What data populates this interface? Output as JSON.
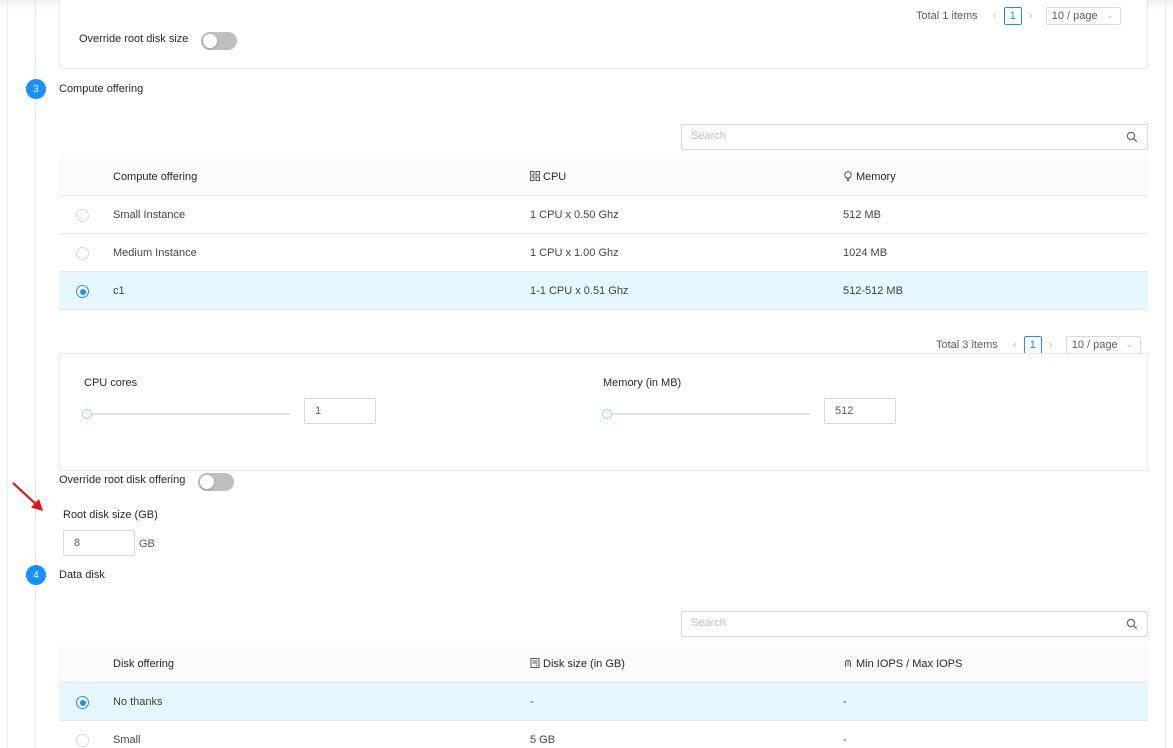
{
  "top_section": {
    "override_root_disk_size_label": "Override root disk size",
    "pagination": {
      "total": "Total 1 items",
      "current_page": "1",
      "page_size": "10 / page"
    }
  },
  "compute_step": {
    "number": "3",
    "title": "Compute offering",
    "search_placeholder": "Search",
    "columns": {
      "name": "Compute offering",
      "cpu": "CPU",
      "memory": "Memory"
    },
    "rows": [
      {
        "name": "Small Instance",
        "cpu": "1 CPU x 0.50 Ghz",
        "memory": "512 MB",
        "selected": false
      },
      {
        "name": "Medium Instance",
        "cpu": "1 CPU x 1.00 Ghz",
        "memory": "1024 MB",
        "selected": false
      },
      {
        "name": "c1",
        "cpu": "1-1 CPU x 0.51 Ghz",
        "memory": "512-512 MB",
        "selected": true
      }
    ],
    "pagination": {
      "total": "Total 3 items",
      "current_page": "1",
      "page_size": "10 / page"
    },
    "custom": {
      "cpu_cores_label": "CPU cores",
      "cpu_cores_value": "1",
      "cpu_cores_slider_fraction": 0,
      "memory_label": "Memory (in MB)",
      "memory_value": "512",
      "memory_slider_fraction": 0
    },
    "override_root_disk_offering_label": "Override root disk offering",
    "root_disk_size_label": "Root disk size (GB)",
    "root_disk_size_value": "8",
    "root_disk_size_unit": "GB"
  },
  "data_disk_step": {
    "number": "4",
    "title": "Data disk",
    "search_placeholder": "Search",
    "columns": {
      "name": "Disk offering",
      "size": "Disk size (in GB)",
      "iops": "Min IOPS / Max IOPS"
    },
    "rows": [
      {
        "name": "No thanks",
        "size": "-",
        "iops": "-",
        "selected": true
      },
      {
        "name": "Small",
        "size": "5 GB",
        "iops": "-",
        "selected": false
      }
    ]
  },
  "colors": {
    "accent": "#1890ff",
    "selected_row": "#e6f7ff",
    "annotation_arrow": "#e8110f"
  }
}
